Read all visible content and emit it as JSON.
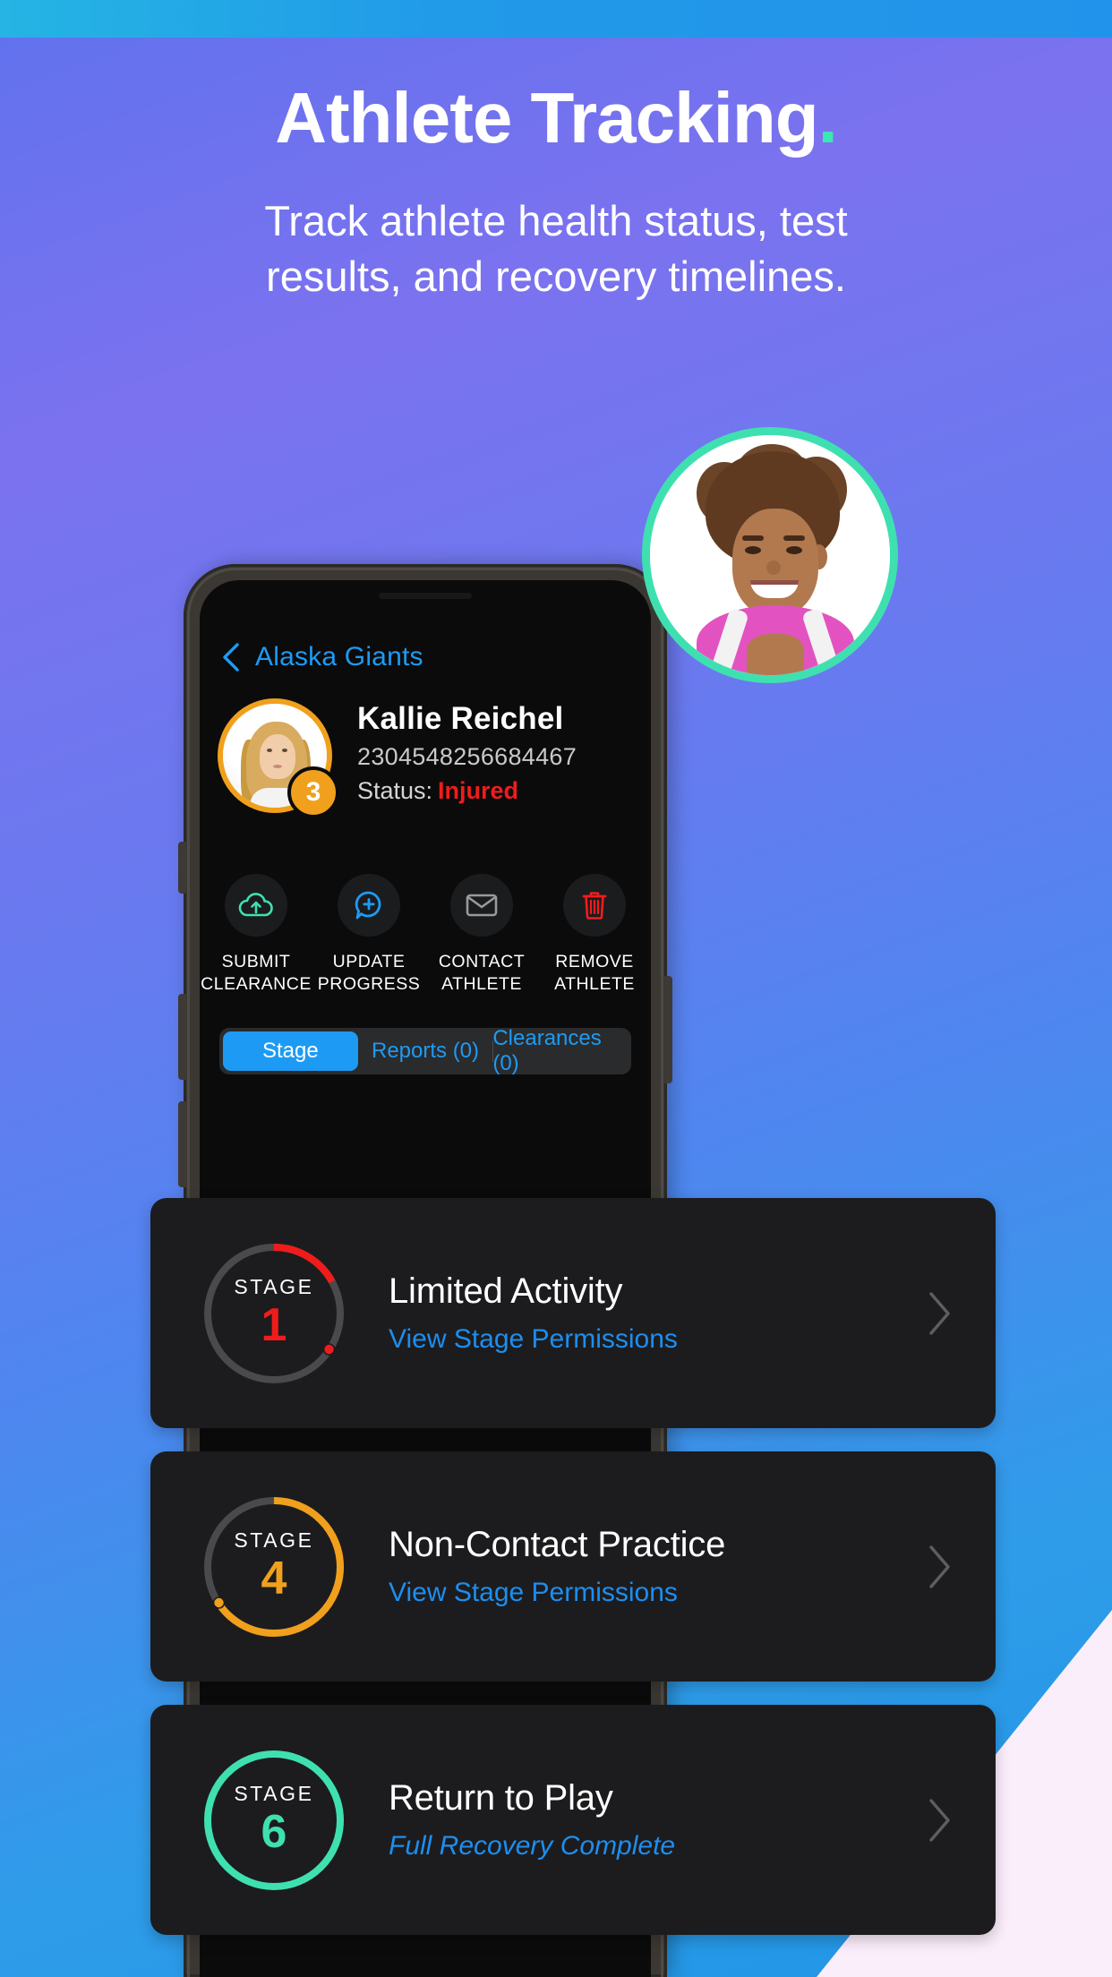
{
  "header": {
    "title": "Athlete Tracking",
    "title_dot": ".",
    "subtitle": "Track athlete health status, test results, and recovery timelines."
  },
  "colors": {
    "accent_blue": "#1d9bf4",
    "accent_green": "#3fe0b0",
    "accent_orange": "#f0a01c",
    "accent_red": "#f01c1c",
    "card_bg": "#1c1c1e",
    "screen_bg": "#0b0b0c"
  },
  "app": {
    "nav": {
      "back_icon": "chevron-left-icon",
      "title": "Alaska Giants"
    },
    "athlete": {
      "avatar_badge": "3",
      "name": "Kallie Reichel",
      "id": "2304548256684467",
      "status_label": "Status:",
      "status_value": "Injured"
    },
    "actions": [
      {
        "icon": "cloud-upload-icon",
        "label": "SUBMIT\nCLEARANCE",
        "line1": "SUBMIT",
        "line2": "CLEARANCE",
        "color": "#3fe0b0"
      },
      {
        "icon": "chat-plus-icon",
        "label": "UPDATE\nPROGRESS",
        "line1": "UPDATE",
        "line2": "PROGRESS",
        "color": "#1d9bf4"
      },
      {
        "icon": "envelope-icon",
        "label": "CONTACT\nATHLETE",
        "line1": "CONTACT",
        "line2": "ATHLETE",
        "color": "#9a9a9a"
      },
      {
        "icon": "trash-icon",
        "label": "REMOVE\nATHLETE",
        "line1": "REMOVE",
        "line2": "ATHLETE",
        "color": "#f01c1c"
      }
    ],
    "tabs": [
      {
        "label": "Stage",
        "active": true
      },
      {
        "label": "Reports (0)",
        "active": false
      },
      {
        "label": "Clearances (0)",
        "active": false
      }
    ],
    "stages": [
      {
        "stage_word": "STAGE",
        "number": "1",
        "title": "Limited Activity",
        "subtitle": "View Stage Permissions",
        "color": "#f01c1c",
        "progress_pct": 17,
        "italic_subtitle": false
      },
      {
        "stage_word": "STAGE",
        "number": "4",
        "title": "Non-Contact Practice",
        "subtitle": "View Stage Permissions",
        "color": "#f0a01c",
        "progress_pct": 67,
        "italic_subtitle": false
      },
      {
        "stage_word": "STAGE",
        "number": "6",
        "title": "Return to Play",
        "subtitle": "Full Recovery Complete",
        "color": "#3fe0b0",
        "progress_pct": 100,
        "italic_subtitle": true
      }
    ]
  }
}
